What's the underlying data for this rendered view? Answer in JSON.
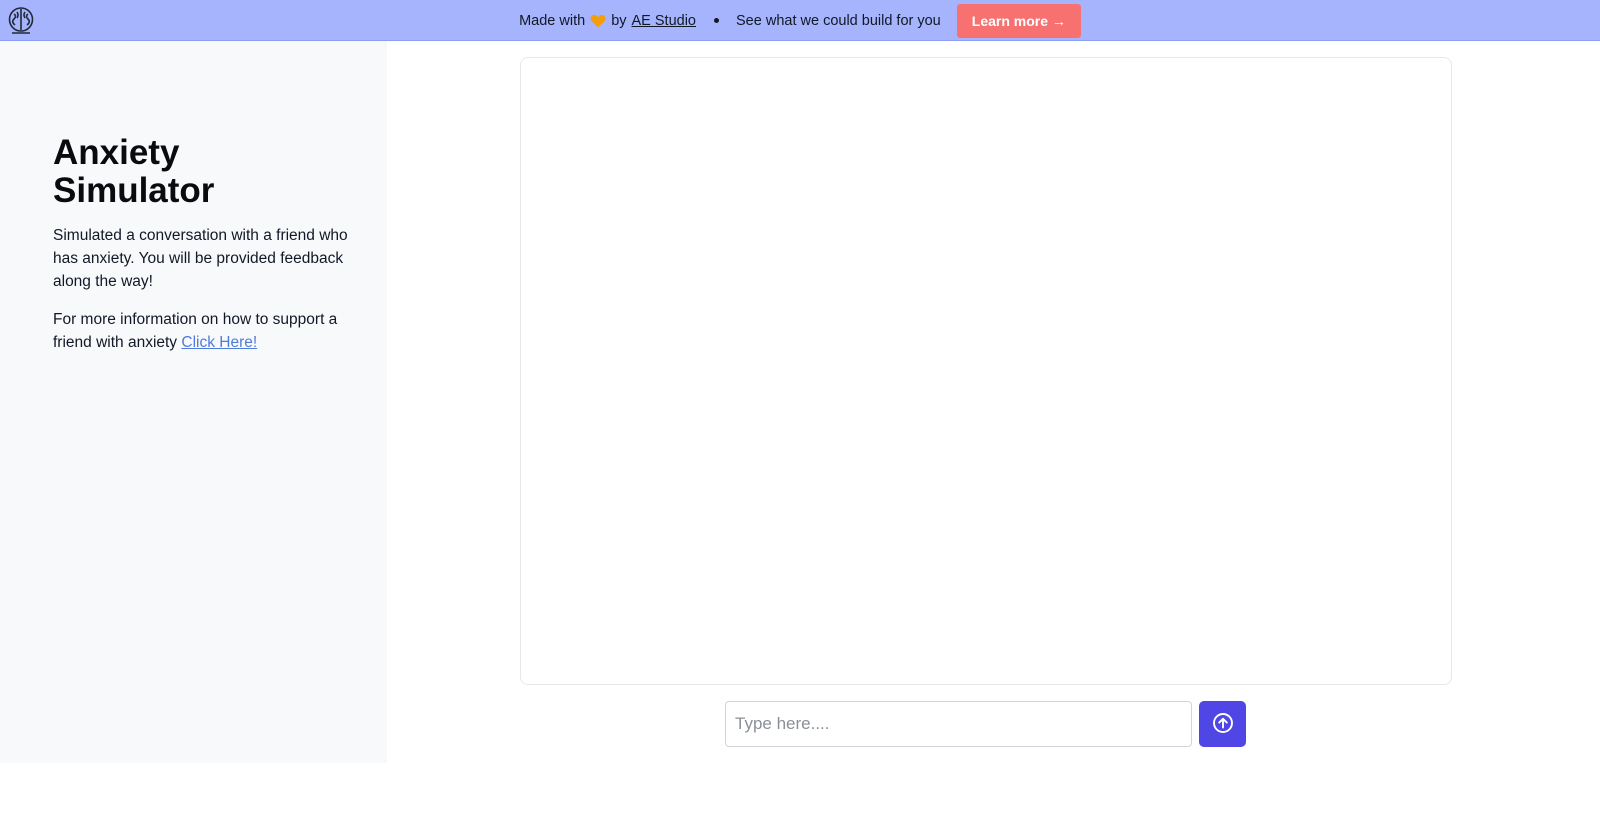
{
  "banner": {
    "logo_icon": "brain-logo-icon",
    "made_with_prefix": "Made with",
    "heart_icon": "orange-heart-icon",
    "heart_color": "#f59e0b",
    "by_text": "by",
    "studio_link": "AE Studio",
    "tagline": "See what we could build for you",
    "cta_label": "Learn more →",
    "background_color": "#a5b4fc",
    "cta_color": "#f87171"
  },
  "sidebar": {
    "title": "Anxiety Simulator",
    "description": "Simulated a conversation with a friend who has anxiety. You will be provided feedback along the way!",
    "info_text": "For more information on how to support a friend with anxiety",
    "info_link": "Click Here!"
  },
  "chat": {
    "messages": []
  },
  "composer": {
    "placeholder": "Type here....",
    "value": "",
    "send_icon": "arrow-up-circle-icon",
    "send_color": "#4f46e5"
  }
}
